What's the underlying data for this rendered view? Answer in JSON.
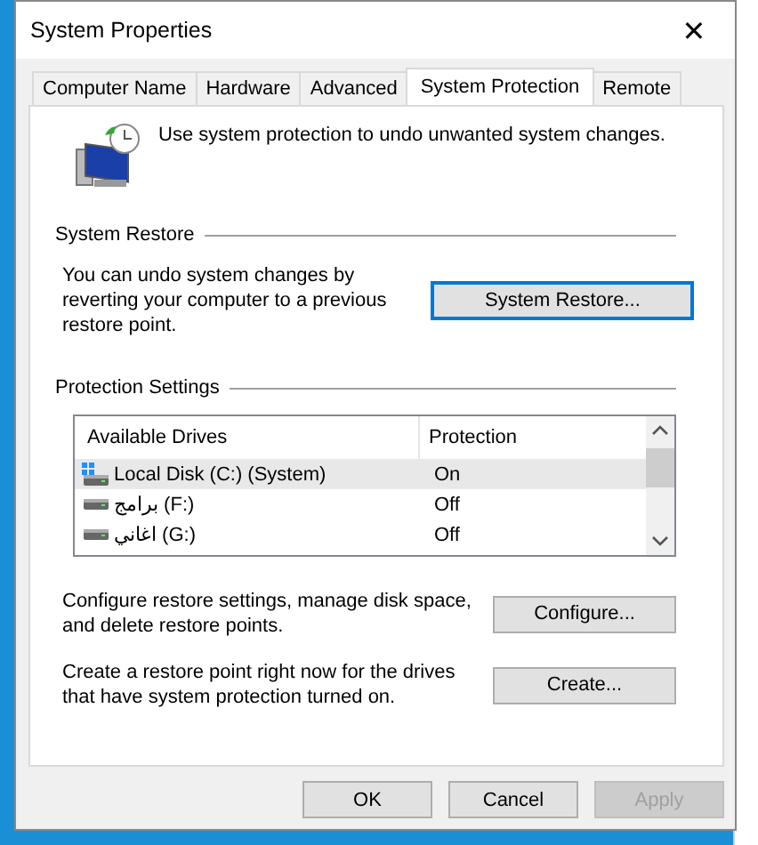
{
  "window": {
    "title": "System Properties",
    "close": "✕"
  },
  "tabs": [
    {
      "label": "Computer Name",
      "selected": false
    },
    {
      "label": "Hardware",
      "selected": false
    },
    {
      "label": "Advanced",
      "selected": false
    },
    {
      "label": "System Protection",
      "selected": true
    },
    {
      "label": "Remote",
      "selected": false
    }
  ],
  "intro": "Use system protection to undo unwanted system changes.",
  "system_restore": {
    "heading": "System Restore",
    "text": "You can undo system changes by reverting your computer to a previous restore point.",
    "button": {
      "label": "System Restore...",
      "focused": true
    }
  },
  "protection_settings": {
    "heading": "Protection Settings",
    "columns": [
      "Available Drives",
      "Protection"
    ],
    "rows": [
      {
        "drive": "Local Disk (C:) (System)",
        "protection": "On",
        "system": true,
        "selected": true
      },
      {
        "drive": "برامج (F:)",
        "protection": "Off",
        "system": false,
        "selected": false
      },
      {
        "drive": "اغاني (G:)",
        "protection": "Off",
        "system": false,
        "selected": false
      }
    ],
    "actions": [
      {
        "text": "Configure restore settings, manage disk space, and delete restore points.",
        "button": "Configure..."
      },
      {
        "text": "Create a restore point right now for the drives that have system protection turned on.",
        "button": "Create..."
      }
    ]
  },
  "buttons": [
    {
      "label": "OK",
      "disabled": false
    },
    {
      "label": "Cancel",
      "disabled": false
    },
    {
      "label": "Apply",
      "disabled": true
    }
  ]
}
